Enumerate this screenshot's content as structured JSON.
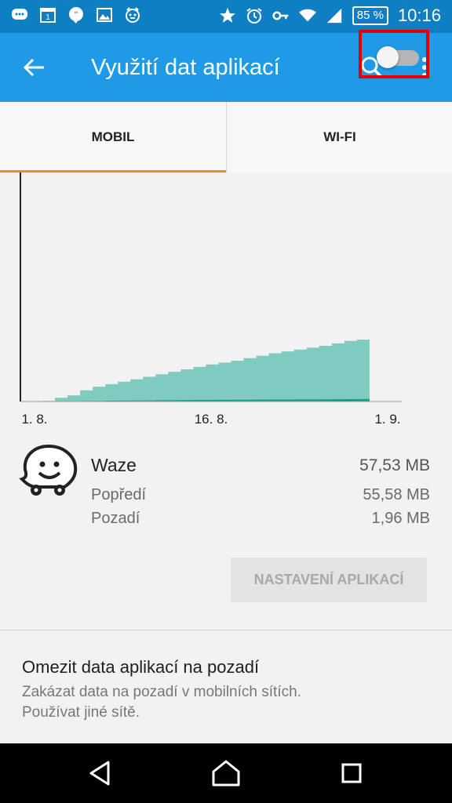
{
  "status_bar": {
    "battery": "85 %",
    "time": "10:16",
    "left_icons": [
      "chat-icon",
      "calendar-icon",
      "quote-icon",
      "image-icon",
      "alarm-robot-icon"
    ],
    "right_icons": [
      "star-icon",
      "alarm-icon",
      "key-icon",
      "wifi-icon",
      "signal-icon"
    ]
  },
  "app_bar": {
    "title": "Využití dat aplikací",
    "back_icon": "arrow-left-icon",
    "search_icon": "search-icon",
    "more_icon": "more-vert-icon"
  },
  "tabs": [
    {
      "label": "MOBIL",
      "selected": true
    },
    {
      "label": "WI-FI",
      "selected": false
    }
  ],
  "colors": {
    "status_bar": "#0d7fc2",
    "app_bar": "#1e9ae6",
    "tab_indicator": "#f28a2b",
    "total_area": "#7fcbbf",
    "background_area": "#129c84",
    "highlight_outline": "#e00000"
  },
  "chart_data": {
    "type": "area",
    "x_ticks": [
      "1. 8.",
      "16. 8.",
      "1. 9."
    ],
    "x": [
      1,
      2,
      3,
      4,
      5,
      6,
      7,
      8,
      9,
      10,
      11,
      12,
      13,
      14,
      15,
      16,
      17,
      18,
      19,
      20,
      21,
      22,
      23,
      24,
      25,
      26
    ],
    "series": [
      {
        "name": "",
        "values": [
          0.5,
          3,
          5,
          9,
          12,
          14,
          16,
          18,
          20,
          22,
          24,
          26,
          28,
          30,
          31.5,
          33,
          35,
          37,
          39,
          40.5,
          42,
          43.5,
          45,
          47,
          49,
          50
        ]
      },
      {
        "name": "",
        "values": [
          0.1,
          0.2,
          0.3,
          0.4,
          0.5,
          0.6,
          0.7,
          0.8,
          0.9,
          1.0,
          1.1,
          1.2,
          1.25,
          1.3,
          1.35,
          1.4,
          1.45,
          1.5,
          1.55,
          1.6,
          1.65,
          1.7,
          1.75,
          1.8,
          1.9,
          1.96
        ]
      }
    ],
    "ylim": [
      0,
      100
    ],
    "grid": false
  },
  "app": {
    "icon": "waze-icon",
    "name": "Waze",
    "total": "57,53 MB",
    "foreground_label": "Popředí",
    "foreground_value": "55,58 MB",
    "background_label": "Pozadí",
    "background_value": "1,96 MB",
    "settings_button": "NASTAVENÍ APLIKACÍ"
  },
  "restrict": {
    "title": "Omezit data aplikací na pozadí",
    "description": "Zakázat data na pozadí v mobilních sítích. Používat jiné sítě.",
    "toggle_on": false
  },
  "nav_bar": {
    "back_icon": "nav-back-icon",
    "home_icon": "nav-home-icon",
    "recents_icon": "nav-recents-icon"
  }
}
